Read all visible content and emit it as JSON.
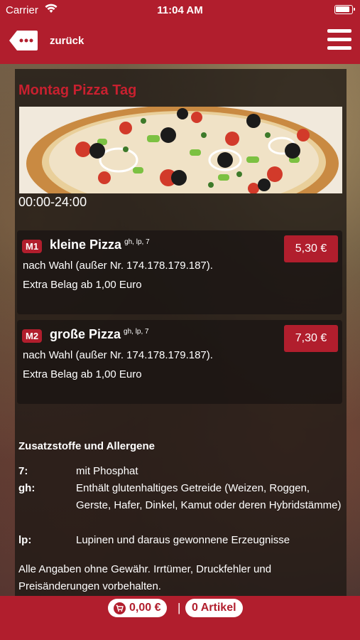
{
  "status_bar": {
    "carrier": "Carrier",
    "time": "11:04 AM"
  },
  "nav": {
    "back_label": "zurück"
  },
  "page": {
    "title": "Montag Pizza Tag",
    "hours": "00:00-24:00"
  },
  "menu_items": [
    {
      "badge": "M1",
      "name": "kleine Pizza",
      "allergens": "gh, lp, 7",
      "description": "nach Wahl (außer Nr. 174.178.179.187). Extra Belag ab 1,00 Euro",
      "price": "5,30 €"
    },
    {
      "badge": "M2",
      "name": "große Pizza",
      "allergens": "gh, lp, 7",
      "description": "nach Wahl (außer Nr. 174.178.179.187). Extra Belag ab 1,00 Euro",
      "price": "7,30 €"
    }
  ],
  "allergen_section": {
    "title": "Zusatzstoffe und Allergene",
    "entries": [
      {
        "key": "7:",
        "value": "mit Phosphat"
      },
      {
        "key": "gh:",
        "value": "Enthält glutenhaltiges Getreide (Weizen, Roggen, Gerste, Hafer, Dinkel, Kamut oder deren Hybridstämme)"
      },
      {
        "key": "lp:",
        "value": "Lupinen und daraus gewonnene Erzeugnisse"
      }
    ],
    "disclaimer": "Alle Angaben ohne Gewähr. Irrtümer, Druckfehler und Preisänderungen vorbehalten."
  },
  "bottom_bar": {
    "cart_total": "0,00 €",
    "separator": "|",
    "item_count": "0 Artikel"
  },
  "colors": {
    "brand_red": "#b11e2d",
    "title_red": "#c8202f"
  }
}
